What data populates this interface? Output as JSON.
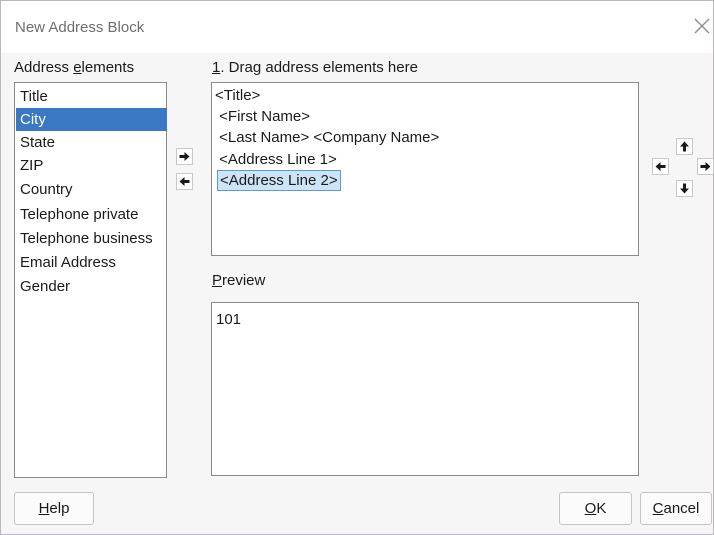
{
  "window": {
    "title": "New Address Block"
  },
  "address_elements": {
    "label_prefix": "Address ",
    "label_mnemonic": "e",
    "label_rest": "lements",
    "items": [
      {
        "label": "Title",
        "selected": false
      },
      {
        "label": "City",
        "selected": true
      },
      {
        "label": "State",
        "selected": false
      },
      {
        "label": "ZIP",
        "selected": false
      },
      {
        "label": "Country",
        "selected": false
      },
      {
        "label": "Telephone private",
        "selected": false
      },
      {
        "label": "Telephone business",
        "selected": false
      },
      {
        "label": "Email Address",
        "selected": false
      },
      {
        "label": "Gender",
        "selected": false
      }
    ]
  },
  "drag_area": {
    "label_mnemonic": "1",
    "label_rest": ". Drag address elements here",
    "lines": [
      "<Title>",
      " <First Name>",
      " <Last Name> <Company Name>",
      " <Address Line 1>",
      "<Address Line 2>"
    ],
    "selected_line": 4
  },
  "preview": {
    "label_mnemonic": "P",
    "label_rest": "review",
    "text": "101"
  },
  "buttons": {
    "help_mnemonic": "H",
    "help_rest": "elp",
    "ok_mnemonic": "O",
    "ok_rest": "K",
    "cancel_mnemonic": "C",
    "cancel_rest": "ancel"
  },
  "icons": {
    "close": "close-icon",
    "add": "arrow-right-icon",
    "remove": "arrow-left-icon",
    "up": "arrow-up-icon",
    "down": "arrow-down-icon",
    "left": "arrow-left-icon",
    "right": "arrow-right-icon"
  },
  "colors": {
    "selection": "#3a78c4",
    "field_selection": "#cde4f7",
    "border": "#8a8a8a"
  }
}
